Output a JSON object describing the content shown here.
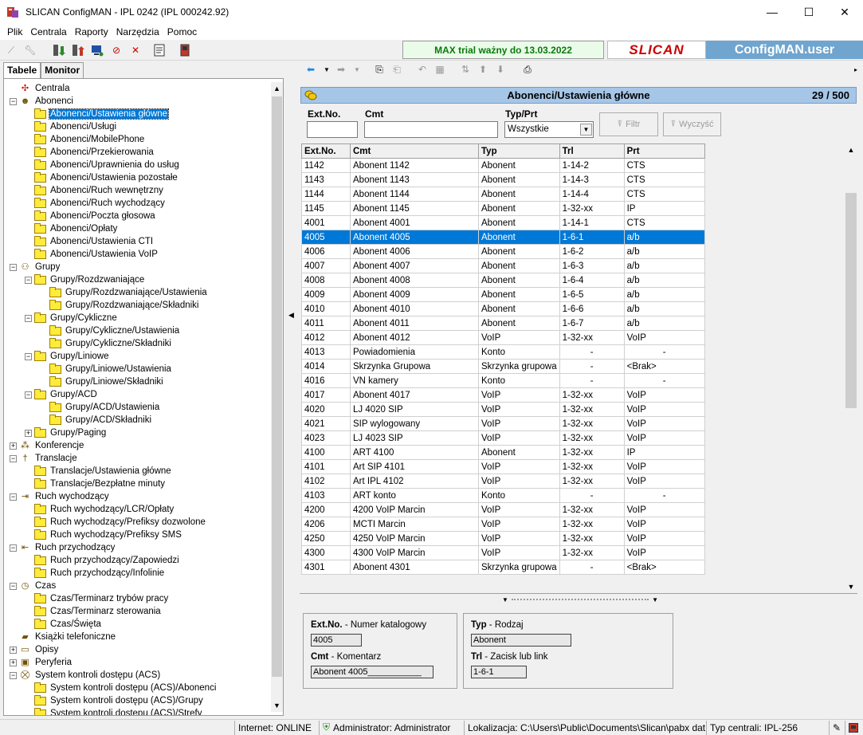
{
  "window": {
    "title": "SLICAN ConfigMAN - IPL 0242 (IPL 000242.92)",
    "minimize": "—",
    "maximize": "☐",
    "close": "✕"
  },
  "menu": [
    "Plik",
    "Centrala",
    "Raporty",
    "Narzędzia",
    "Pomoc"
  ],
  "banner": {
    "trial": "MAX trial ważny do 13.03.2022",
    "logo": "SLICAN",
    "product": "ConfigMAN.user"
  },
  "left_tabs": [
    "Tabele",
    "Monitor"
  ],
  "tree": [
    {
      "label": "Centrala",
      "level": 0,
      "exp": "",
      "icon": "pbx-icon"
    },
    {
      "label": "Abonenci",
      "level": 0,
      "exp": "−",
      "icon": "users-icon"
    },
    {
      "label": "Abonenci/Ustawienia główne",
      "level": 1,
      "exp": "",
      "icon": "folder",
      "selected": true
    },
    {
      "label": "Abonenci/Usługi",
      "level": 1,
      "exp": "",
      "icon": "folder"
    },
    {
      "label": "Abonenci/MobilePhone",
      "level": 1,
      "exp": "",
      "icon": "folder"
    },
    {
      "label": "Abonenci/Przekierowania",
      "level": 1,
      "exp": "",
      "icon": "folder"
    },
    {
      "label": "Abonenci/Uprawnienia do usług",
      "level": 1,
      "exp": "",
      "icon": "folder"
    },
    {
      "label": "Abonenci/Ustawienia pozostałe",
      "level": 1,
      "exp": "",
      "icon": "folder"
    },
    {
      "label": "Abonenci/Ruch wewnętrzny",
      "level": 1,
      "exp": "",
      "icon": "folder"
    },
    {
      "label": "Abonenci/Ruch wychodzący",
      "level": 1,
      "exp": "",
      "icon": "folder"
    },
    {
      "label": "Abonenci/Poczta głosowa",
      "level": 1,
      "exp": "",
      "icon": "folder"
    },
    {
      "label": "Abonenci/Opłaty",
      "level": 1,
      "exp": "",
      "icon": "folder"
    },
    {
      "label": "Abonenci/Ustawienia CTI",
      "level": 1,
      "exp": "",
      "icon": "folder"
    },
    {
      "label": "Abonenci/Ustawienia VoIP",
      "level": 1,
      "exp": "",
      "icon": "folder"
    },
    {
      "label": "Grupy",
      "level": 0,
      "exp": "−",
      "icon": "groups-icon"
    },
    {
      "label": "Grupy/Rozdzwaniające",
      "level": 1,
      "exp": "−",
      "icon": "folder"
    },
    {
      "label": "Grupy/Rozdzwaniające/Ustawienia",
      "level": 2,
      "exp": "",
      "icon": "folder"
    },
    {
      "label": "Grupy/Rozdzwaniające/Składniki",
      "level": 2,
      "exp": "",
      "icon": "folder"
    },
    {
      "label": "Grupy/Cykliczne",
      "level": 1,
      "exp": "−",
      "icon": "folder"
    },
    {
      "label": "Grupy/Cykliczne/Ustawienia",
      "level": 2,
      "exp": "",
      "icon": "folder"
    },
    {
      "label": "Grupy/Cykliczne/Składniki",
      "level": 2,
      "exp": "",
      "icon": "folder"
    },
    {
      "label": "Grupy/Liniowe",
      "level": 1,
      "exp": "−",
      "icon": "folder"
    },
    {
      "label": "Grupy/Liniowe/Ustawienia",
      "level": 2,
      "exp": "",
      "icon": "folder"
    },
    {
      "label": "Grupy/Liniowe/Składniki",
      "level": 2,
      "exp": "",
      "icon": "folder"
    },
    {
      "label": "Grupy/ACD",
      "level": 1,
      "exp": "−",
      "icon": "folder"
    },
    {
      "label": "Grupy/ACD/Ustawienia",
      "level": 2,
      "exp": "",
      "icon": "folder"
    },
    {
      "label": "Grupy/ACD/Składniki",
      "level": 2,
      "exp": "",
      "icon": "folder"
    },
    {
      "label": "Grupy/Paging",
      "level": 1,
      "exp": "+",
      "icon": "folder"
    },
    {
      "label": "Konferencje",
      "level": 0,
      "exp": "+",
      "icon": "conference-icon"
    },
    {
      "label": "Translacje",
      "level": 0,
      "exp": "−",
      "icon": "translation-icon"
    },
    {
      "label": "Translacje/Ustawienia główne",
      "level": 1,
      "exp": "",
      "icon": "folder"
    },
    {
      "label": "Translacje/Bezpłatne minuty",
      "level": 1,
      "exp": "",
      "icon": "folder"
    },
    {
      "label": "Ruch wychodzący",
      "level": 0,
      "exp": "−",
      "icon": "outgoing-icon"
    },
    {
      "label": "Ruch wychodzący/LCR/Opłaty",
      "level": 1,
      "exp": "",
      "icon": "folder"
    },
    {
      "label": "Ruch wychodzący/Prefiksy dozwolone",
      "level": 1,
      "exp": "",
      "icon": "folder"
    },
    {
      "label": "Ruch wychodzący/Prefiksy SMS",
      "level": 1,
      "exp": "",
      "icon": "folder"
    },
    {
      "label": "Ruch przychodzący",
      "level": 0,
      "exp": "−",
      "icon": "incoming-icon"
    },
    {
      "label": "Ruch przychodzący/Zapowiedzi",
      "level": 1,
      "exp": "",
      "icon": "folder"
    },
    {
      "label": "Ruch przychodzący/Infolinie",
      "level": 1,
      "exp": "",
      "icon": "folder"
    },
    {
      "label": "Czas",
      "level": 0,
      "exp": "−",
      "icon": "clock-icon"
    },
    {
      "label": "Czas/Terminarz trybów pracy",
      "level": 1,
      "exp": "",
      "icon": "folder"
    },
    {
      "label": "Czas/Terminarz sterowania",
      "level": 1,
      "exp": "",
      "icon": "folder"
    },
    {
      "label": "Czas/Święta",
      "level": 1,
      "exp": "",
      "icon": "folder"
    },
    {
      "label": "Książki telefoniczne",
      "level": 0,
      "exp": "",
      "icon": "phonebook-icon"
    },
    {
      "label": "Opisy",
      "level": 0,
      "exp": "+",
      "icon": "descriptions-icon"
    },
    {
      "label": "Peryferia",
      "level": 0,
      "exp": "+",
      "icon": "peripherals-icon"
    },
    {
      "label": "System kontroli dostępu (ACS)",
      "level": 0,
      "exp": "−",
      "icon": "acs-icon"
    },
    {
      "label": "System kontroli dostępu (ACS)/Abonenci",
      "level": 1,
      "exp": "",
      "icon": "folder"
    },
    {
      "label": "System kontroli dostępu (ACS)/Grupy",
      "level": 1,
      "exp": "",
      "icon": "folder"
    },
    {
      "label": "System kontroli dostępu (ACS)/Strefy",
      "level": 1,
      "exp": "",
      "icon": "folder"
    }
  ],
  "panel": {
    "title": "Abonenci/Ustawienia główne",
    "count": "29 / 500"
  },
  "filters": {
    "ext_label": "Ext.No.",
    "cmt_label": "Cmt",
    "typ_label": "Typ/Prt",
    "select_value": "Wszystkie",
    "filter_btn": "Filtr",
    "clear_btn": "Wyczyść"
  },
  "grid": {
    "columns": [
      "Ext.No.",
      "Cmt",
      "Typ",
      "Trl",
      "Prt"
    ],
    "rows": [
      [
        "1142",
        "Abonent 1142",
        "Abonent",
        "1-14-2",
        "CTS"
      ],
      [
        "1143",
        "Abonent 1143",
        "Abonent",
        "1-14-3",
        "CTS"
      ],
      [
        "1144",
        "Abonent 1144",
        "Abonent",
        "1-14-4",
        "CTS"
      ],
      [
        "1145",
        "Abonent 1145",
        "Abonent",
        "1-32-xx",
        "IP"
      ],
      [
        "4001",
        "Abonent 4001",
        "Abonent",
        "1-14-1",
        "CTS"
      ],
      [
        "4005",
        "Abonent 4005",
        "Abonent",
        "1-6-1",
        "a/b"
      ],
      [
        "4006",
        "Abonent 4006",
        "Abonent",
        "1-6-2",
        "a/b"
      ],
      [
        "4007",
        "Abonent 4007",
        "Abonent",
        "1-6-3",
        "a/b"
      ],
      [
        "4008",
        "Abonent 4008",
        "Abonent",
        "1-6-4",
        "a/b"
      ],
      [
        "4009",
        "Abonent 4009",
        "Abonent",
        "1-6-5",
        "a/b"
      ],
      [
        "4010",
        "Abonent 4010",
        "Abonent",
        "1-6-6",
        "a/b"
      ],
      [
        "4011",
        "Abonent 4011",
        "Abonent",
        "1-6-7",
        "a/b"
      ],
      [
        "4012",
        "Abonent 4012",
        "VoIP",
        "1-32-xx",
        "VoIP"
      ],
      [
        "4013",
        "Powiadomienia",
        "Konto",
        "-",
        "-"
      ],
      [
        "4014",
        "Skrzynka Grupowa",
        "Skrzynka grupowa",
        "-",
        "<Brak>"
      ],
      [
        "4016",
        "VN kamery",
        "Konto",
        "-",
        "-"
      ],
      [
        "4017",
        "Abonent 4017",
        "VoIP",
        "1-32-xx",
        "VoIP"
      ],
      [
        "4020",
        "LJ 4020 SIP",
        "VoIP",
        "1-32-xx",
        "VoIP"
      ],
      [
        "4021",
        "SIP wylogowany",
        "VoIP",
        "1-32-xx",
        "VoIP"
      ],
      [
        "4023",
        "LJ 4023 SIP",
        "VoIP",
        "1-32-xx",
        "VoIP"
      ],
      [
        "4100",
        "ART 4100",
        "Abonent",
        "1-32-xx",
        "IP"
      ],
      [
        "4101",
        "Art SIP 4101",
        "VoIP",
        "1-32-xx",
        "VoIP"
      ],
      [
        "4102",
        "Art IPL  4102",
        "VoIP",
        "1-32-xx",
        "VoIP"
      ],
      [
        "4103",
        "ART konto",
        "Konto",
        "-",
        "-"
      ],
      [
        "4200",
        "4200 VoIP Marcin",
        "VoIP",
        "1-32-xx",
        "VoIP"
      ],
      [
        "4206",
        "MCTI Marcin",
        "VoIP",
        "1-32-xx",
        "VoIP"
      ],
      [
        "4250",
        "4250 VoIP Marcin",
        "VoIP",
        "1-32-xx",
        "VoIP"
      ],
      [
        "4300",
        "4300 VoIP Marcin",
        "VoIP",
        "1-32-xx",
        "VoIP"
      ],
      [
        "4301",
        "Abonent 4301",
        "Skrzynka grupowa",
        "-",
        "<Brak>"
      ]
    ],
    "selected_row": 5
  },
  "details": {
    "ext_key": "Ext.No.",
    "ext_desc": " - Numer katalogowy",
    "ext_value": "4005",
    "cmt_key": "Cmt",
    "cmt_desc": " - Komentarz",
    "cmt_value": "Abonent 4005___________",
    "typ_key": "Typ",
    "typ_desc": " - Rodzaj",
    "typ_value": "Abonent",
    "trl_key": "Trl",
    "trl_desc": " - Zacisk lub link",
    "trl_value": "1-6-1"
  },
  "status": {
    "internet": "Internet: ONLINE",
    "admin": "Administrator: Administrator",
    "location": "Lokalizacja: C:\\Users\\Public\\Documents\\Slican\\pabx dat",
    "type": "Typ centrali: IPL-256"
  }
}
